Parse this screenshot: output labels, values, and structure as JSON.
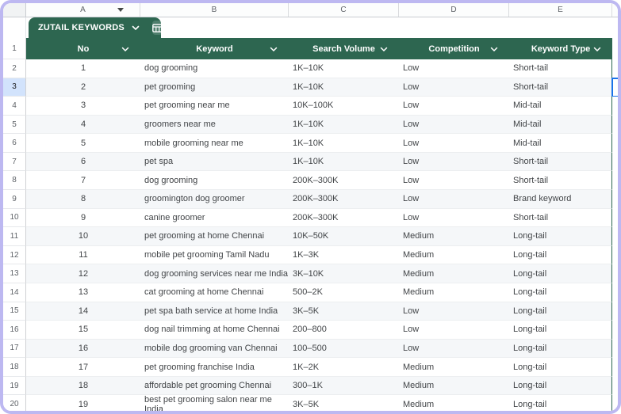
{
  "window": {
    "border_color": "#bdb8f1"
  },
  "column_letters": [
    "A",
    "B",
    "C",
    "D",
    "E"
  ],
  "tab": {
    "label": "ZUTAIL KEYWORDS"
  },
  "selection": {
    "row": 3,
    "accent_color": "#1a73e8",
    "row_header_highlight": "#d2e3fc"
  },
  "icons": {
    "tab_chevron": "chevron-down-icon",
    "tab_table": "table-icon",
    "header_chevron": "chevron-down-icon",
    "column_a_filter": "filter-dropdown-icon"
  },
  "table": {
    "header_color": "#2d6650",
    "banding_color": "#f5f7f9",
    "headers": [
      "No",
      "Keyword",
      "Search Volume",
      "Competition",
      "Keyword Type"
    ],
    "rows": [
      {
        "r": 2,
        "no": "1",
        "keyword": "dog grooming",
        "volume": "1K–10K",
        "competition": "Low",
        "type": "Short-tail"
      },
      {
        "r": 3,
        "no": "2",
        "keyword": "pet grooming",
        "volume": "1K–10K",
        "competition": "Low",
        "type": "Short-tail"
      },
      {
        "r": 4,
        "no": "3",
        "keyword": "pet grooming near me",
        "volume": "10K–100K",
        "competition": "Low",
        "type": "Mid-tail"
      },
      {
        "r": 5,
        "no": "4",
        "keyword": "groomers near me",
        "volume": "1K–10K",
        "competition": "Low",
        "type": "Mid-tail"
      },
      {
        "r": 6,
        "no": "5",
        "keyword": "mobile grooming near me",
        "volume": "1K–10K",
        "competition": "Low",
        "type": "Mid-tail"
      },
      {
        "r": 7,
        "no": "6",
        "keyword": "pet spa",
        "volume": "1K–10K",
        "competition": "Low",
        "type": "Short-tail"
      },
      {
        "r": 8,
        "no": "7",
        "keyword": "dog grooming",
        "volume": "200K–300K",
        "competition": "Low",
        "type": "Short-tail"
      },
      {
        "r": 9,
        "no": "8",
        "keyword": "groomington dog groomer",
        "volume": "200K–300K",
        "competition": "Low",
        "type": "Brand keyword"
      },
      {
        "r": 10,
        "no": "9",
        "keyword": "canine groomer",
        "volume": "200K–300K",
        "competition": "Low",
        "type": "Short-tail"
      },
      {
        "r": 11,
        "no": "10",
        "keyword": "pet grooming at home Chennai",
        "volume": "10K–50K",
        "competition": "Medium",
        "type": "Long-tail"
      },
      {
        "r": 12,
        "no": "11",
        "keyword": "mobile pet grooming Tamil Nadu",
        "volume": "1K–3K",
        "competition": "Medium",
        "type": "Long-tail"
      },
      {
        "r": 13,
        "no": "12",
        "keyword": "dog grooming services near me India",
        "volume": "3K–10K",
        "competition": "Medium",
        "type": "Long-tail"
      },
      {
        "r": 14,
        "no": "13",
        "keyword": "cat grooming at home Chennai",
        "volume": "500–2K",
        "competition": "Medium",
        "type": "Long-tail"
      },
      {
        "r": 15,
        "no": "14",
        "keyword": "pet spa bath service at home India",
        "volume": "3K–5K",
        "competition": "Low",
        "type": "Long-tail"
      },
      {
        "r": 16,
        "no": "15",
        "keyword": "dog nail trimming at home Chennai",
        "volume": "200–800",
        "competition": "Low",
        "type": "Long-tail"
      },
      {
        "r": 17,
        "no": "16",
        "keyword": "mobile dog grooming van Chennai",
        "volume": "100–500",
        "competition": "Low",
        "type": "Long-tail"
      },
      {
        "r": 18,
        "no": "17",
        "keyword": "pet grooming franchise India",
        "volume": "1K–2K",
        "competition": "Medium",
        "type": "Long-tail"
      },
      {
        "r": 19,
        "no": "18",
        "keyword": "affordable pet grooming Chennai",
        "volume": "300–1K",
        "competition": "Medium",
        "type": "Long-tail"
      },
      {
        "r": 20,
        "no": "19",
        "keyword": "best pet grooming salon near me India",
        "volume": "3K–5K",
        "competition": "Medium",
        "type": "Long-tail"
      }
    ]
  }
}
